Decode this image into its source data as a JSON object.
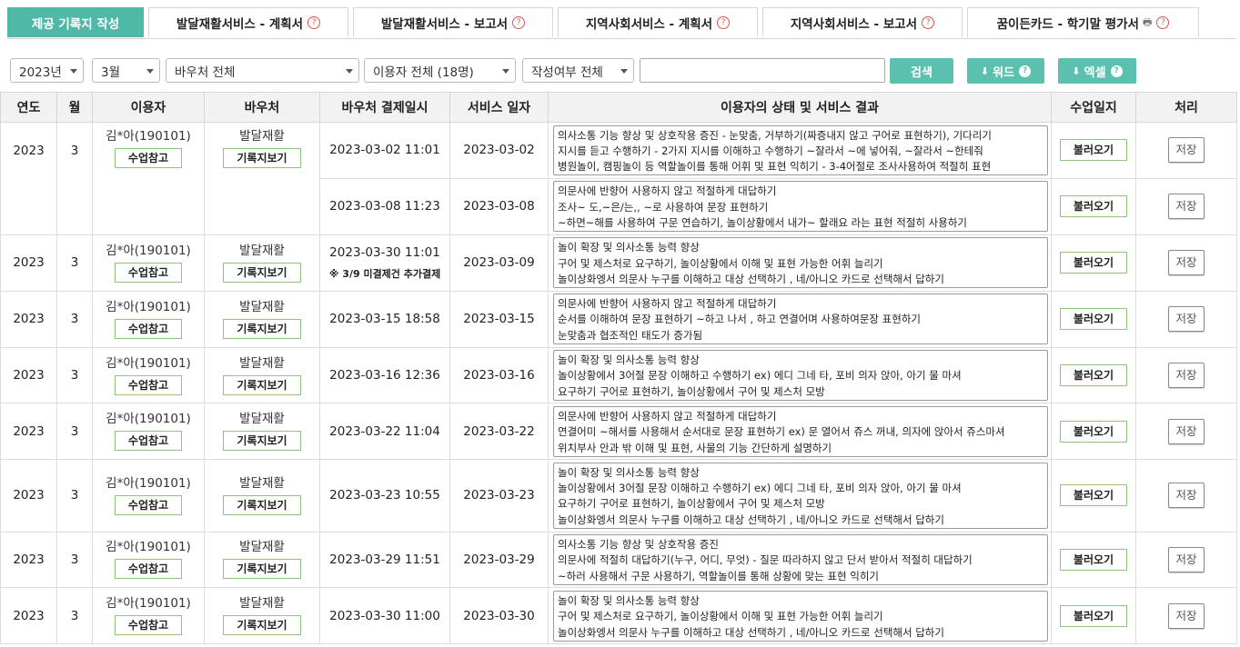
{
  "tabs": [
    {
      "label": "제공 기록지 작성",
      "active": true,
      "help": false,
      "print": false
    },
    {
      "label": "발달재활서비스 - 계획서",
      "active": false,
      "help": true,
      "print": false
    },
    {
      "label": "발달재활서비스 - 보고서",
      "active": false,
      "help": true,
      "print": false
    },
    {
      "label": "지역사회서비스 - 계획서",
      "active": false,
      "help": true,
      "print": false
    },
    {
      "label": "지역사회서비스 - 보고서",
      "active": false,
      "help": true,
      "print": false
    },
    {
      "label": "꿈이든카드 - 학기말 평가서",
      "active": false,
      "help": true,
      "print": true
    }
  ],
  "filters": {
    "year": "2023년",
    "month": "3월",
    "voucher": "바우처 전체",
    "user": "이용자 전체 (18명)",
    "status": "작성여부 전체",
    "search_value": "",
    "search_label": "검색",
    "word_label": "워드",
    "excel_label": "엑셀"
  },
  "table": {
    "headers": [
      "연도",
      "월",
      "이용자",
      "바우처",
      "바우처 결제일시",
      "서비스 일자",
      "이용자의 상태 및 서비스 결과",
      "수업일지",
      "처리"
    ],
    "groups": [
      {
        "year": "2023",
        "month": "3",
        "user": "김*아(190101)",
        "user_btn": "수업참고",
        "voucher": "발달재활",
        "voucher_btn": "기록지보기",
        "rows": [
          {
            "paid": "2023-03-02 11:01",
            "note": "",
            "date": "2023-03-02",
            "result": [
              "의사소통 기능 향상 및 상호작용 증진 - 눈맞춤, 거부하기(짜증내지 않고 구어로 표현하기), 기다리기",
              "지시를 듣고 수행하기 - 2가지 지시를 이해하고 수행하기 ~잘라서 ~에 넣어줘, ~잘라서 ~한테줘",
              "병원놀이, 캠핑놀이 등 역할놀이를 통해 어휘 및 표현 익히기 - 3-4어절로 조사사용하여 적절히 표현"
            ],
            "load": "불러오기",
            "save": "저장"
          },
          {
            "paid": "2023-03-08 11:23",
            "note": "",
            "date": "2023-03-08",
            "result": [
              "의문사에 반향어 사용하지 않고 적절하게 대답하기",
              "조사~ 도,~은/는,, ~로 사용하여 문장 표현하기",
              "~하면~해를 사용하여 구문 연습하기, 놀이상황에서 내가~ 할래요 라는 표현 적절히 사용하기"
            ],
            "load": "불러오기",
            "save": "저장"
          }
        ]
      },
      {
        "year": "2023",
        "month": "3",
        "user": "김*아(190101)",
        "user_btn": "수업참고",
        "voucher": "발달재활",
        "voucher_btn": "기록지보기",
        "rows": [
          {
            "paid": "2023-03-30 11:01",
            "note": "※ 3/9 미결제건 추가결제",
            "date": "2023-03-09",
            "result": [
              "놀이 확장 및 의사소통 능력 향상",
              "구어 및 제스처로 요구하기, 놀이상황에서 이해 및 표현 가능한 어휘 늘리기",
              "놀이상화엥서 의문사 누구를 이해하고 대상 선택하기 , 네/아니오 카드로 선택해서 답하기"
            ],
            "load": "불러오기",
            "save": "저장"
          }
        ]
      },
      {
        "year": "2023",
        "month": "3",
        "user": "김*아(190101)",
        "user_btn": "수업참고",
        "voucher": "발달재활",
        "voucher_btn": "기록지보기",
        "rows": [
          {
            "paid": "2023-03-15 18:58",
            "note": "",
            "date": "2023-03-15",
            "result": [
              "의문사에 반향어 사용하지 않고 적절하게 대답하기",
              "순서를 이해하여 문장 표현하기 ~하고 나서 , 하고 연결어며 사용하여문장 표현하기",
              "눈맞춤과 협조적인 태도가 증가됨"
            ],
            "load": "불러오기",
            "save": "저장"
          }
        ]
      },
      {
        "year": "2023",
        "month": "3",
        "user": "김*아(190101)",
        "user_btn": "수업참고",
        "voucher": "발달재활",
        "voucher_btn": "기록지보기",
        "rows": [
          {
            "paid": "2023-03-16 12:36",
            "note": "",
            "date": "2023-03-16",
            "result": [
              "놀이 확장 및 의사소통 능력 향상",
              "놀이상황에서 3어절 문장 이해하고 수행하기 ex) 에디 그네 타, 포비 의자 앉아, 아기 물 마셔",
              "요구하기 구어로 표현하기, 놀이상황에서 구어 및 제스처 모방"
            ],
            "load": "불러오기",
            "save": "저장"
          }
        ]
      },
      {
        "year": "2023",
        "month": "3",
        "user": "김*아(190101)",
        "user_btn": "수업참고",
        "voucher": "발달재활",
        "voucher_btn": "기록지보기",
        "rows": [
          {
            "paid": "2023-03-22 11:04",
            "note": "",
            "date": "2023-03-22",
            "result": [
              "의문사에 반향어 사용하지 않고 적절하게 대답하기",
              "연결어미 ~해서를 사용해서 순서대로 문장 표현하기 ex) 문 열어서 쥬스 꺼내, 의자에 앉아서 쥬스마셔",
              "위치부사 안과 밖 이해 및 표현, 사물의 기능 간단하게 설명하기"
            ],
            "load": "불러오기",
            "save": "저장"
          }
        ]
      },
      {
        "year": "2023",
        "month": "3",
        "user": "김*아(190101)",
        "user_btn": "수업참고",
        "voucher": "발달재활",
        "voucher_btn": "기록지보기",
        "rows": [
          {
            "paid": "2023-03-23 10:55",
            "note": "",
            "date": "2023-03-23",
            "result": [
              "놀이 확장 및 의사소통 능력 향상",
              "놀이상황에서 3어절 문장 이해하고 수행하기 ex) 에디 그네 타, 포비 의자 앉아, 아기 물 마셔",
              "요구하기 구어로 표현하기, 놀이상황에서 구어 및 제스처 모방",
              "놀이상화엥서 의문사 누구를 이해하고 대상 선택하기 , 네/아니오 카드로 선택해서 답하기"
            ],
            "load": "불러오기",
            "save": "저장"
          }
        ]
      },
      {
        "year": "2023",
        "month": "3",
        "user": "김*아(190101)",
        "user_btn": "수업참고",
        "voucher": "발달재활",
        "voucher_btn": "기록지보기",
        "rows": [
          {
            "paid": "2023-03-29 11:51",
            "note": "",
            "date": "2023-03-29",
            "result": [
              "의사소통 기능 향상 및 상호작용 증진",
              "의문사에 적절히 대답하기(누구, 어디, 무엇) - 질문 따라하지 않고 단서 받아서 적절히 대답하기",
              "~하러 사용해서 구문 사용하기, 역할놀이를 통해 상황에 맞는 표현 익히기"
            ],
            "load": "불러오기",
            "save": "저장"
          }
        ]
      },
      {
        "year": "2023",
        "month": "3",
        "user": "김*아(190101)",
        "user_btn": "수업참고",
        "voucher": "발달재활",
        "voucher_btn": "기록지보기",
        "rows": [
          {
            "paid": "2023-03-30 11:00",
            "note": "",
            "date": "2023-03-30",
            "result": [
              "놀이 확장 및 의사소통 능력 향상",
              "구어 및 제스처로 요구하기, 놀이상황에서 이해 및 표현 가능한 어휘 늘리기",
              "놀이상화엥서 의문사 누구를 이해하고 대상 선택하기 , 네/아니오 카드로 선택해서 답하기"
            ],
            "load": "불러오기",
            "save": "저장"
          }
        ]
      }
    ]
  }
}
